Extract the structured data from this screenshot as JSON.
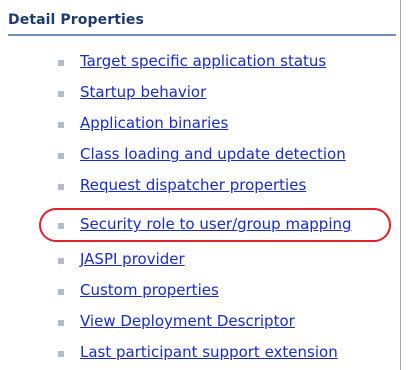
{
  "section": {
    "title": "Detail Properties"
  },
  "properties": [
    {
      "label": "Target specific application status",
      "highlighted": false
    },
    {
      "label": "Startup behavior",
      "highlighted": false
    },
    {
      "label": "Application binaries",
      "highlighted": false
    },
    {
      "label": "Class loading and update detection",
      "highlighted": false
    },
    {
      "label": "Request dispatcher properties",
      "highlighted": false
    },
    {
      "label": "Security role to user/group mapping",
      "highlighted": true
    },
    {
      "label": "JASPI provider",
      "highlighted": false
    },
    {
      "label": "Custom properties",
      "highlighted": false
    },
    {
      "label": "View Deployment Descriptor",
      "highlighted": false
    },
    {
      "label": "Last participant support extension",
      "highlighted": false
    }
  ],
  "colors": {
    "link": "#1a2cc8",
    "header_text": "#1d3b6e",
    "header_rule": "#6d8fbf",
    "bullet": "#b5bcc8",
    "highlight": "#e0202a"
  }
}
